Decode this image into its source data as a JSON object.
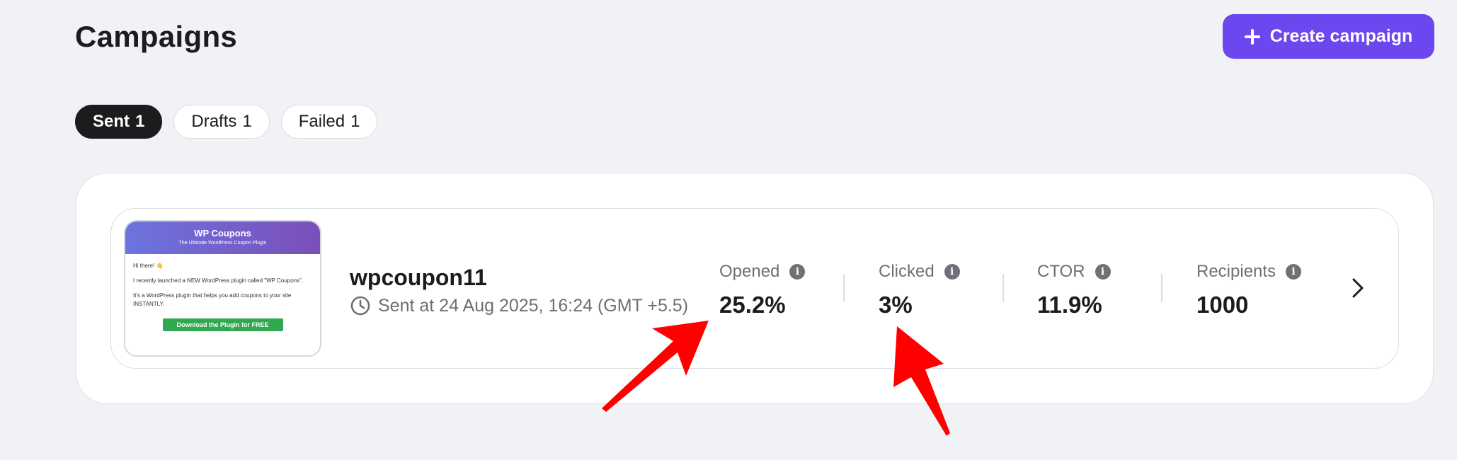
{
  "header": {
    "title": "Campaigns",
    "create_button_label": "Create campaign"
  },
  "tabs": [
    {
      "label": "Sent",
      "count": "1",
      "active": true
    },
    {
      "label": "Drafts",
      "count": "1",
      "active": false
    },
    {
      "label": "Failed",
      "count": "1",
      "active": false
    }
  ],
  "campaign": {
    "name": "wpcoupon11",
    "sent_at": "Sent at 24 Aug 2025, 16:24 (GMT +5.5)",
    "preview": {
      "title": "WP Coupons",
      "subtitle": "The Ultimate WordPress Coupon Plugin",
      "greeting": "Hi there! 👋",
      "line1": "I recently launched a NEW WordPress plugin called \"WP Coupons\".",
      "line2": "It's a WordPress plugin that helps you add coupons to your site INSTANTLY.",
      "cta": "Download the Plugin for FREE"
    },
    "stats": [
      {
        "label": "Opened",
        "value": "25.2%"
      },
      {
        "label": "Clicked",
        "value": "3%"
      },
      {
        "label": "CTOR",
        "value": "11.9%"
      },
      {
        "label": "Recipients",
        "value": "1000"
      }
    ]
  },
  "colors": {
    "accent": "#6c47f0",
    "background": "#f1f2f5",
    "annotation_arrow": "#ff0000"
  },
  "icons": [
    "plus-icon",
    "clock-icon",
    "info-icon",
    "chevron-right-icon",
    "arrow-annotation"
  ]
}
